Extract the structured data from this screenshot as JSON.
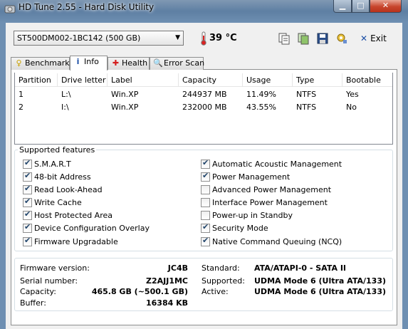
{
  "window": {
    "title": "HD Tune 2.55 - Hard Disk Utility",
    "minimize_glyph": "▁",
    "maximize_glyph": "□",
    "close_glyph": "✕"
  },
  "toolbar": {
    "drive": "ST500DM002-1BC142 (500 GB)",
    "temperature": "39 °C",
    "icons": [
      "copy-text-icon",
      "copy-screenshot-icon",
      "save-icon",
      "options-icon"
    ],
    "exit_label": "Exit"
  },
  "tabs": [
    {
      "label": "Benchmark",
      "icon": "benchmark-icon",
      "active": false
    },
    {
      "label": "Info",
      "icon": "info-icon",
      "active": true
    },
    {
      "label": "Health",
      "icon": "health-icon",
      "active": false
    },
    {
      "label": "Error Scan",
      "icon": "error-scan-icon",
      "active": false
    }
  ],
  "partitions": {
    "headers": [
      "Partition",
      "Drive letter",
      "Label",
      "Capacity",
      "Usage",
      "Type",
      "Bootable"
    ],
    "rows": [
      [
        "1",
        "L:\\",
        "Win.XP",
        "244937 MB",
        "11.49%",
        "NTFS",
        "Yes"
      ],
      [
        "2",
        "I:\\",
        "Win.XP",
        "232000 MB",
        "43.55%",
        "NTFS",
        "No"
      ]
    ]
  },
  "features": {
    "title": "Supported features",
    "left": [
      {
        "label": "S.M.A.R.T",
        "checked": true
      },
      {
        "label": "48-bit Address",
        "checked": true
      },
      {
        "label": "Read Look-Ahead",
        "checked": true
      },
      {
        "label": "Write Cache",
        "checked": true
      },
      {
        "label": "Host Protected Area",
        "checked": true
      },
      {
        "label": "Device Configuration Overlay",
        "checked": true
      },
      {
        "label": "Firmware Upgradable",
        "checked": true
      }
    ],
    "right": [
      {
        "label": "Automatic Acoustic Management",
        "checked": true
      },
      {
        "label": "Power Management",
        "checked": true
      },
      {
        "label": "Advanced Power Management",
        "checked": false
      },
      {
        "label": "Interface Power Management",
        "checked": false
      },
      {
        "label": "Power-up in Standby",
        "checked": false
      },
      {
        "label": "Security Mode",
        "checked": true
      },
      {
        "label": "Native Command Queuing (NCQ)",
        "checked": true
      }
    ]
  },
  "details": {
    "firmware_label": "Firmware version:",
    "firmware_value": "JC4B",
    "serial_label": "Serial number:",
    "serial_value": "Z2AJJ1MC",
    "capacity_label": "Capacity:",
    "capacity_value": "465.8 GB (~500.1 GB)",
    "buffer_label": "Buffer:",
    "buffer_value": "16384 KB",
    "standard_label": "Standard:",
    "standard_value": "ATA/ATAPI-0 - SATA II",
    "supported_label": "Supported:",
    "supported_value": "UDMA Mode 6 (Ultra ATA/133)",
    "active_label": "Active:",
    "active_value": "UDMA Mode 6 (Ultra ATA/133)"
  }
}
